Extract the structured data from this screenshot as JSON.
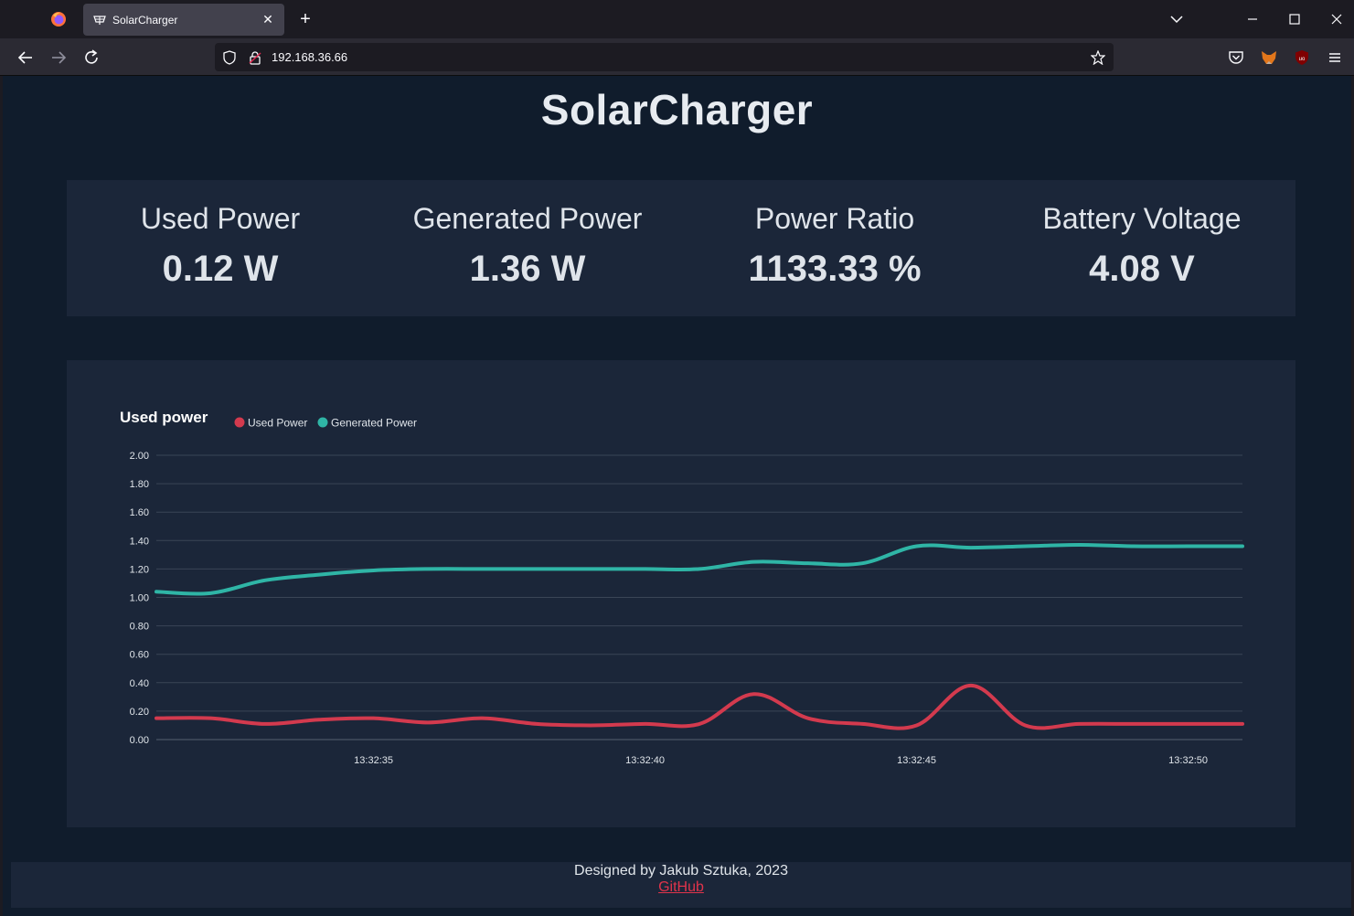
{
  "browser": {
    "tab_title": "SolarCharger",
    "tab_close": "✕",
    "new_tab": "+",
    "url": "192.168.36.66"
  },
  "page": {
    "title": "SolarCharger",
    "stats": [
      {
        "label": "Used Power",
        "value": "0.12 W"
      },
      {
        "label": "Generated Power",
        "value": "1.36 W"
      },
      {
        "label": "Power Ratio",
        "value": "1133.33 %"
      },
      {
        "label": "Battery Voltage",
        "value": "4.08 V"
      }
    ]
  },
  "chart_data": {
    "type": "line",
    "title": "Used power",
    "legend_position": "top-left",
    "grid": true,
    "ylim": [
      0,
      2
    ],
    "yticks": [
      "0.00",
      "0.20",
      "0.40",
      "0.60",
      "0.80",
      "1.00",
      "1.20",
      "1.40",
      "1.60",
      "1.80",
      "2.00"
    ],
    "xticks": [
      {
        "t": 35,
        "label": "13:32:35"
      },
      {
        "t": 40,
        "label": "13:32:40"
      },
      {
        "t": 45,
        "label": "13:32:45"
      },
      {
        "t": 50,
        "label": "13:32:50"
      }
    ],
    "x": [
      31,
      32,
      33,
      34,
      35,
      36,
      37,
      38,
      39,
      40,
      41,
      42,
      43,
      44,
      45,
      46,
      47,
      48,
      49,
      50,
      51
    ],
    "series": [
      {
        "name": "Used Power",
        "color": "#d33a4e",
        "values": [
          0.15,
          0.15,
          0.11,
          0.14,
          0.15,
          0.12,
          0.15,
          0.11,
          0.1,
          0.11,
          0.11,
          0.32,
          0.15,
          0.11,
          0.1,
          0.38,
          0.1,
          0.11,
          0.11,
          0.11,
          0.11
        ]
      },
      {
        "name": "Generated Power",
        "color": "#2fb5a6",
        "values": [
          1.04,
          1.03,
          1.12,
          1.16,
          1.19,
          1.2,
          1.2,
          1.2,
          1.2,
          1.2,
          1.2,
          1.25,
          1.24,
          1.24,
          1.36,
          1.35,
          1.36,
          1.37,
          1.36,
          1.36,
          1.36
        ]
      }
    ]
  },
  "footer": {
    "credit": "Designed by Jakub Sztuka, 2023",
    "link": "GitHub"
  },
  "colors": {
    "page_bg": "#101c2c",
    "card_bg": "#1b2639",
    "used": "#d33a4e",
    "generated": "#2fb5a6",
    "link": "#e0344b"
  }
}
